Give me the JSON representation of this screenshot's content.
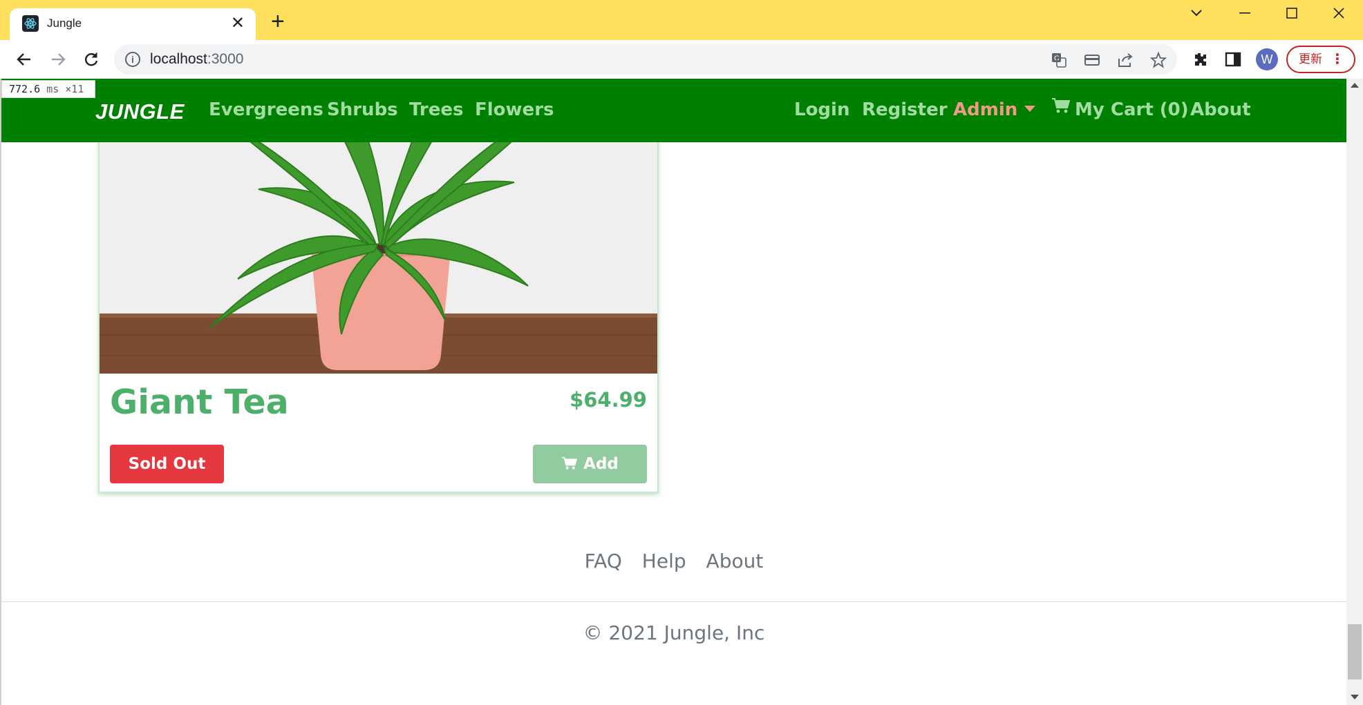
{
  "browser": {
    "tab_title": "Jungle",
    "url_host": "localhost",
    "url_rest": ":3000",
    "update_label": "更新",
    "profile_initial": "W"
  },
  "perf_overlay": {
    "value": "772.6",
    "unit": "ms",
    "count": "×11"
  },
  "navbar": {
    "brand": "JUNGLE",
    "categories": [
      "Evergreens",
      "Shrubs",
      "Trees",
      "Flowers"
    ],
    "login": "Login",
    "register": "Register",
    "admin": "Admin",
    "cart": "My Cart (0)",
    "about": "About",
    "bg_color": "#008000",
    "link_color": "#a3dca3",
    "admin_color": "#f29a86"
  },
  "product": {
    "name": "Giant Tea",
    "price": "$64.99",
    "sold_out_label": "Sold Out",
    "add_label": "Add",
    "accent_color": "#4caf6a"
  },
  "footer": {
    "links": [
      "FAQ",
      "Help",
      "About"
    ],
    "copyright": "© 2021 Jungle, Inc"
  }
}
